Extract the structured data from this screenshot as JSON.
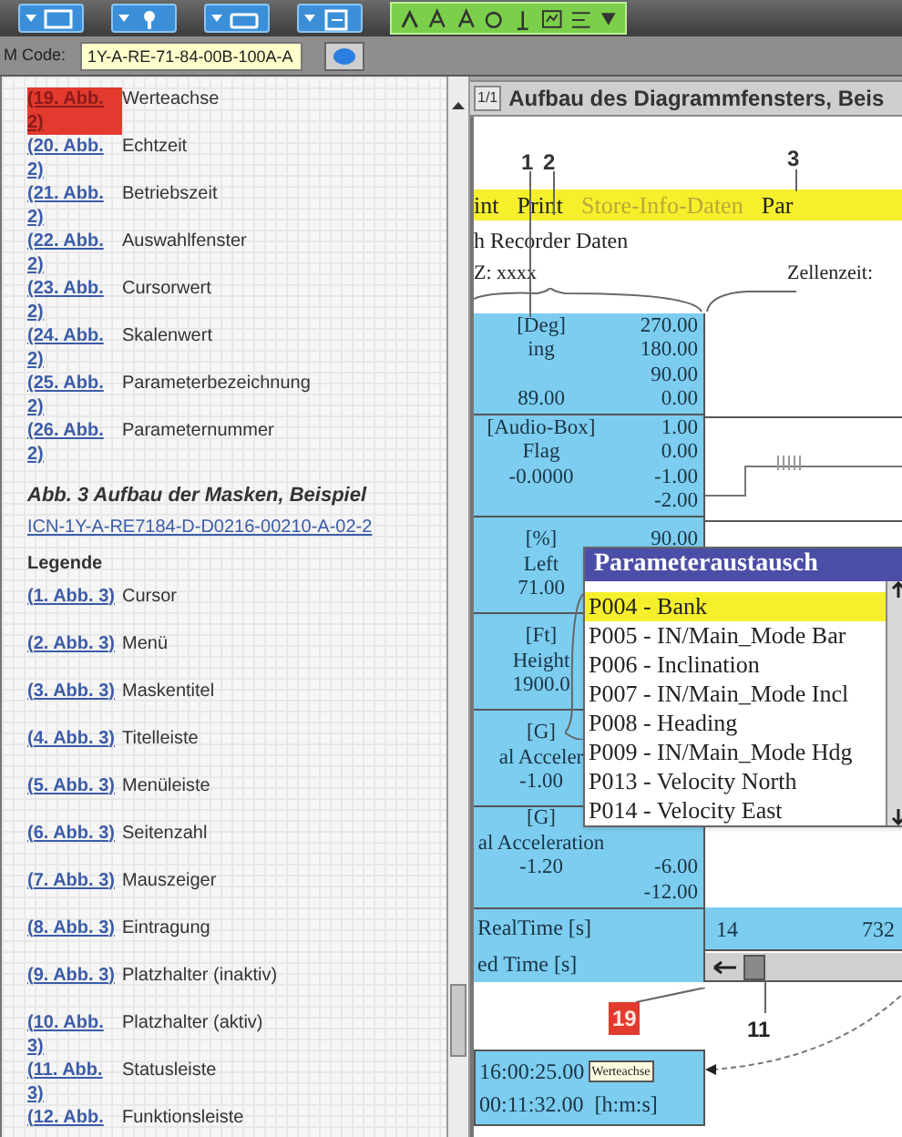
{
  "code_bar": {
    "label": "M Code:",
    "value": "1Y-A-RE-71-84-00B-100A-A"
  },
  "figure_links": [
    {
      "link": "(19. Abb. 2)",
      "caption": "Werteachse",
      "selected": true
    },
    {
      "link": "(20. Abb. 2)",
      "caption": "Echtzeit",
      "selected": false
    },
    {
      "link": "(21. Abb. 2)",
      "caption": "Betriebszeit",
      "selected": false
    },
    {
      "link": "(22. Abb. 2)",
      "caption": "Auswahlfenster",
      "selected": false
    },
    {
      "link": "(23. Abb. 2)",
      "caption": "Cursorwert",
      "selected": false
    },
    {
      "link": "(24. Abb. 2)",
      "caption": "Skalenwert",
      "selected": false
    },
    {
      "link": "(25. Abb. 2)",
      "caption": "Parameterbezeichnung",
      "selected": false
    },
    {
      "link": "(26. Abb. 2)",
      "caption": "Parameternummer",
      "selected": false
    }
  ],
  "figure_caption": "Abb. 3 Aufbau der Masken, Beispiel",
  "icn_link": "ICN-1Y-A-RE7184-D-D0216-00210-A-02-2",
  "legend_title": "Legende",
  "legend": [
    {
      "link": "(1. Abb. 3)",
      "caption": "Cursor",
      "selected": false
    },
    {
      "link": "(2. Abb. 3)",
      "caption": "Menü",
      "selected": false
    },
    {
      "link": "(3. Abb. 3)",
      "caption": "Maskentitel",
      "selected": false
    },
    {
      "link": "(4. Abb. 3)",
      "caption": "Titelleiste",
      "selected": false
    },
    {
      "link": "(5. Abb. 3)",
      "caption": "Menüleiste",
      "selected": false
    },
    {
      "link": "(6. Abb. 3)",
      "caption": "Seitenzahl",
      "selected": false
    },
    {
      "link": "(7. Abb. 3)",
      "caption": "Mauszeiger",
      "selected": false
    },
    {
      "link": "(8. Abb. 3)",
      "caption": "Eintragung",
      "selected": false
    },
    {
      "link": "(9. Abb. 3)",
      "caption": "Platzhalter (inaktiv)",
      "selected": false
    },
    {
      "link": "(10. Abb. 3)",
      "caption": "Platzhalter (aktiv)",
      "selected": false
    },
    {
      "link": "(11. Abb. 3)",
      "caption": "Statusleiste",
      "selected": false
    },
    {
      "link": "(12. Abb.",
      "caption": "Funktionsleiste",
      "selected": false
    }
  ],
  "figure_window": {
    "page": "1/1",
    "title": "Aufbau des Diagrammfensters, Beis",
    "callouts": [
      "1",
      "2",
      "3"
    ],
    "menu": [
      "int",
      "Print",
      "Store-Info-Daten",
      "Par"
    ],
    "recorder_title": "h Recorder Daten",
    "zone": "Z: xxxx",
    "cell_time": "Zellenzeit:",
    "blocks": [
      [
        {
          "label": "[Deg]",
          "value": "270.00"
        },
        {
          "label": "ing",
          "value": "180.00"
        },
        {
          "value": "90.00"
        },
        {
          "label": "89.00",
          "value": "0.00"
        }
      ],
      [
        {
          "label": "[Audio-Box]",
          "value": "1.00"
        },
        {
          "label": "Flag",
          "value": "0.00"
        },
        {
          "label": "-0.0000",
          "value": "-1.00"
        },
        {
          "value": "-2.00"
        }
      ],
      [
        {
          "label": "[%]",
          "value": "90.00"
        },
        {
          "label": "Left"
        },
        {
          "label": "71.00"
        }
      ],
      [
        {
          "label": "[Ft]"
        },
        {
          "label": "Height"
        },
        {
          "label": "1900.0"
        }
      ],
      [
        {
          "label": "[G]"
        },
        {
          "label": "al Acceler"
        },
        {
          "label": "-1.00"
        }
      ],
      [
        {
          "label": "[G]"
        },
        {
          "label": "al Acceleration"
        },
        {
          "label": "-1.20",
          "value": "-6.00"
        },
        {
          "value": "-12.00"
        }
      ]
    ],
    "time_rows": [
      "RealTime [s]",
      "ed Time [s]"
    ],
    "time_axis": [
      "14",
      "732"
    ],
    "popup": {
      "title": "Parameteraustausch",
      "items": [
        {
          "label": "P004 - Bank",
          "selected": true
        },
        {
          "label": "P005 - IN/Main_Mode Bar",
          "selected": false
        },
        {
          "label": "P006 - Inclination",
          "selected": false
        },
        {
          "label": "P007 - IN/Main_Mode Incl",
          "selected": false
        },
        {
          "label": "P008 - Heading",
          "selected": false
        },
        {
          "label": "P009 - IN/Main_Mode Hdg",
          "selected": false
        },
        {
          "label": "P013 - Velocity North",
          "selected": false
        },
        {
          "label": "P014 - Velocity East",
          "selected": false
        }
      ]
    },
    "marker_19": "19",
    "marker_11": "11",
    "status": {
      "real_time": "16:00:25.00",
      "tooltip": "Werteachse",
      "run_time": "00:11:32.00",
      "unit": "[h:m:s]"
    }
  }
}
